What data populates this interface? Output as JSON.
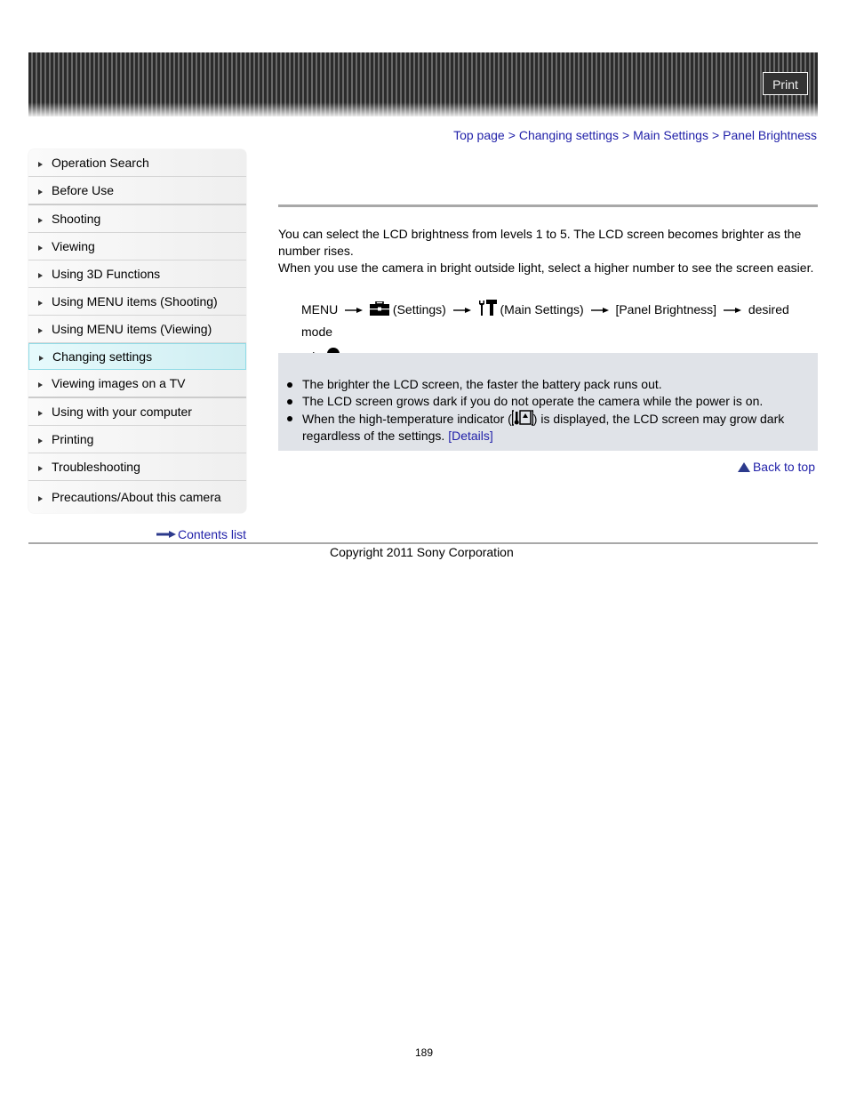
{
  "header": {
    "print_label": "Print"
  },
  "breadcrumb": {
    "items": [
      "Top page",
      "Changing settings",
      "Main Settings",
      "Panel Brightness"
    ],
    "separator": ">"
  },
  "sidebar": {
    "items": [
      {
        "label": "Operation Search"
      },
      {
        "label": "Before Use"
      },
      {
        "label": "Shooting"
      },
      {
        "label": "Viewing"
      },
      {
        "label": "Using 3D Functions"
      },
      {
        "label": "Using MENU items (Shooting)"
      },
      {
        "label": "Using MENU items (Viewing)"
      },
      {
        "label": "Changing settings",
        "active": true
      },
      {
        "label": "Viewing images on a TV"
      },
      {
        "label": "Using with your computer"
      },
      {
        "label": "Printing"
      },
      {
        "label": "Troubleshooting"
      },
      {
        "label": "Precautions/About this camera"
      }
    ],
    "contents_list": "Contents list"
  },
  "main": {
    "intro_1": "You can select the LCD brightness from levels 1 to 5. The LCD screen becomes brighter as the number rises.",
    "intro_2": "When you use the camera in bright outside light, select a higher number to see the screen easier.",
    "menu_path": {
      "menu": "MENU",
      "settings": "(Settings)",
      "main_settings": "(Main Settings)",
      "panel_brightness": "[Panel Brightness]",
      "desired_mode": "desired mode"
    },
    "notes": [
      "The brighter the LCD screen, the faster the battery pack runs out.",
      "The LCD screen grows dark if you do not operate the camera while the power is on."
    ],
    "note_3_before": "When the high-temperature indicator (",
    "note_3_after": ") is displayed, the LCD screen may grow dark regardless of the settings. ",
    "details_link": "[Details]",
    "back_to_top": "Back to top"
  },
  "footer": {
    "copyright": "Copyright 2011 Sony Corporation",
    "page_number": "189"
  },
  "colors": {
    "link": "#1f1fa8",
    "note_bg": "#e0e3e8",
    "active_nav": "#d9f4f8"
  }
}
